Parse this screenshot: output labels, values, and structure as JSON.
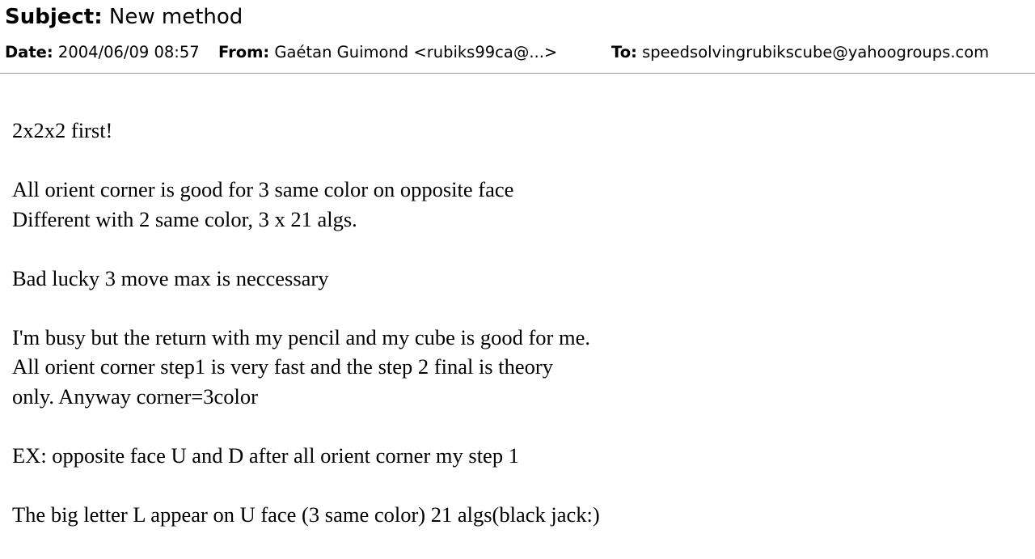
{
  "header": {
    "subject_label": "Subject:",
    "subject": "New method",
    "date_label": "Date:",
    "date": "2004/06/09 08:57",
    "from_label": "From:",
    "from": "Gaétan Guimond <rubiks99ca@...>",
    "to_label": "To:",
    "to": "speedsolvingrubikscube@yahoogroups.com"
  },
  "body": {
    "paragraphs": [
      {
        "lines": [
          "2x2x2 first!"
        ]
      },
      {
        "lines": [
          "All orient corner is good for 3 same color on opposite face",
          "Different with 2 same color, 3 x 21 algs."
        ]
      },
      {
        "lines": [
          "Bad lucky 3 move max is neccessary"
        ]
      },
      {
        "lines": [
          "I'm busy but the return with my pencil and my cube is good for me.",
          "All orient corner step1 is very fast and the step 2 final is theory",
          "only. Anyway corner=3color"
        ]
      },
      {
        "lines": [
          "EX: opposite face U and D after all orient corner my step 1"
        ]
      },
      {
        "lines": [
          "The big letter L appear on U face (3 same color) 21 algs(black jack:)"
        ]
      }
    ]
  }
}
